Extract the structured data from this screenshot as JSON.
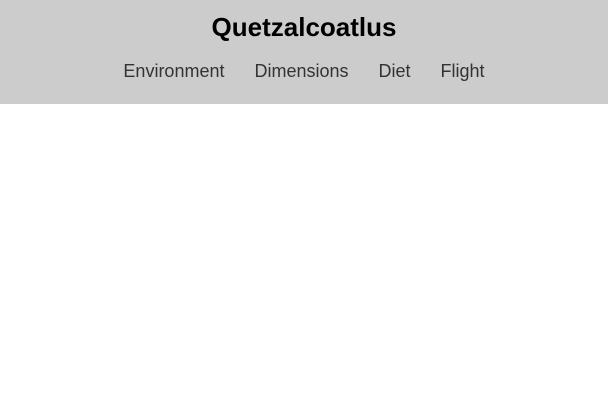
{
  "header": {
    "title": "Quetzalcoatlus",
    "nav": [
      {
        "label": "Environment"
      },
      {
        "label": "Dimensions"
      },
      {
        "label": "Diet"
      },
      {
        "label": "Flight"
      }
    ]
  },
  "colors": {
    "header_background": "#cccccc",
    "page_background": "#ffffff",
    "title_text": "#000000",
    "nav_text": "#333333"
  }
}
